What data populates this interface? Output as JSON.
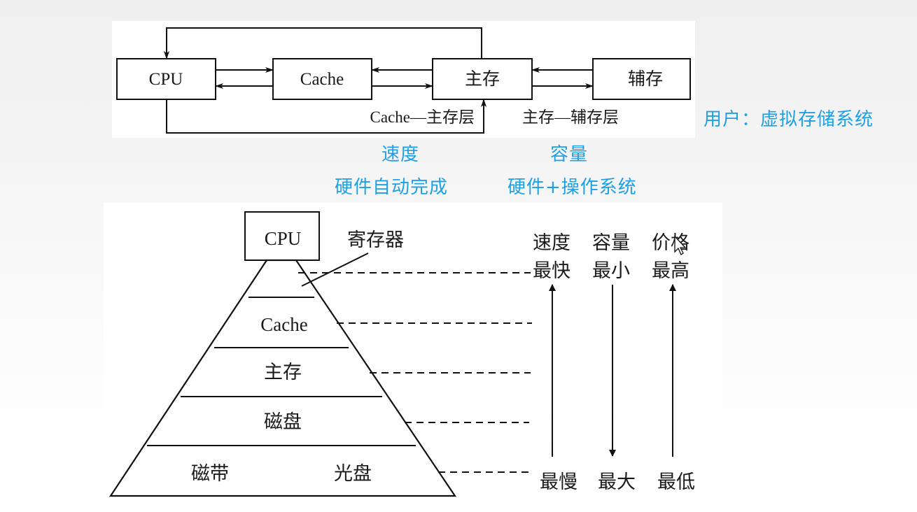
{
  "top_diagram": {
    "boxes": {
      "cpu": "CPU",
      "cache": "Cache",
      "main_memory": "主存",
      "aux_memory": "辅存"
    },
    "labels": {
      "cache_main_level": "Cache—主存层",
      "main_aux_level": "主存—辅存层"
    }
  },
  "annotations": {
    "user_virtual": "用户：虚拟存储系统",
    "speed": "速度",
    "capacity": "容量",
    "hardware_auto": "硬件自动完成",
    "hardware_os": "硬件+操作系统",
    "color": "#1ea0e6"
  },
  "pyramid": {
    "cpu": "CPU",
    "register_label": "寄存器",
    "levels": [
      "Cache",
      "主存",
      "磁盘"
    ],
    "bottom_left": "磁带",
    "bottom_right": "光盘"
  },
  "metrics": {
    "columns": [
      {
        "name": "速度",
        "top": "最快",
        "bottom": "最慢",
        "arrow": "up"
      },
      {
        "name": "容量",
        "top": "最小",
        "bottom": "最大",
        "arrow": "down"
      },
      {
        "name": "价格",
        "top": "最高",
        "bottom": "最低",
        "arrow": "up"
      }
    ]
  }
}
